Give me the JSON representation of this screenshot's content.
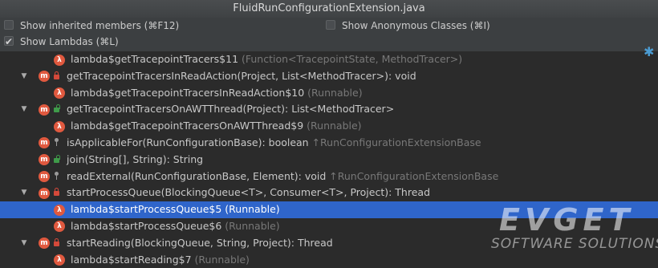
{
  "window": {
    "title": "FluidRunConfigurationExtension.java"
  },
  "options": {
    "show_inherited": {
      "label": "Show inherited members (⌘F12)",
      "checked": false
    },
    "show_anonymous": {
      "label": "Show Anonymous Classes (⌘I)",
      "checked": false
    },
    "show_lambdas": {
      "label": "Show Lambdas (⌘L)",
      "checked": true
    }
  },
  "tree": {
    "rows": [
      {
        "name": "lambda$getTracepointTracers$11",
        "detail": " (Function<TracepointState, MethodTracer>)"
      },
      {
        "name": "getTracepointTracersInReadAction(Project, List<MethodTracer>): void",
        "detail": ""
      },
      {
        "name": "lambda$getTracepointTracersInReadAction$10",
        "detail": " (Runnable)"
      },
      {
        "name": "getTracepointTracersOnAWTThread(Project): List<MethodTracer>",
        "detail": ""
      },
      {
        "name": "lambda$getTracepointTracersOnAWTThread$9",
        "detail": " (Runnable)"
      },
      {
        "name": "isApplicableFor(RunConfigurationBase): boolean",
        "detail": " ↑RunConfigurationExtensionBase"
      },
      {
        "name": "join(String[], String): String",
        "detail": ""
      },
      {
        "name": "readExternal(RunConfigurationBase, Element): void",
        "detail": " ↑RunConfigurationExtensionBase"
      },
      {
        "name": "startProcessQueue(BlockingQueue<T>, Consumer<T>, Project): Thread",
        "detail": ""
      },
      {
        "name": "lambda$startProcessQueue$5",
        "detail": " (Runnable)"
      },
      {
        "name": "lambda$startProcessQueue$6",
        "detail": " (Runnable)"
      },
      {
        "name": "startReading(BlockingQueue, String, Project): Thread",
        "detail": ""
      },
      {
        "name": "lambda$startReading$7",
        "detail": " (Runnable)"
      }
    ]
  },
  "icons": {
    "lambda_glyph": "λ",
    "method_glyph": "m",
    "expand_glyph": "▼",
    "gear_glyph": "✱"
  },
  "watermark": {
    "brand": "EVGET",
    "tagline": "SOFTWARE SOLUTIONS"
  },
  "colors": {
    "selection": "#2f65ca",
    "icon_bg": "#e0593f",
    "gear": "#4b9cd3"
  }
}
